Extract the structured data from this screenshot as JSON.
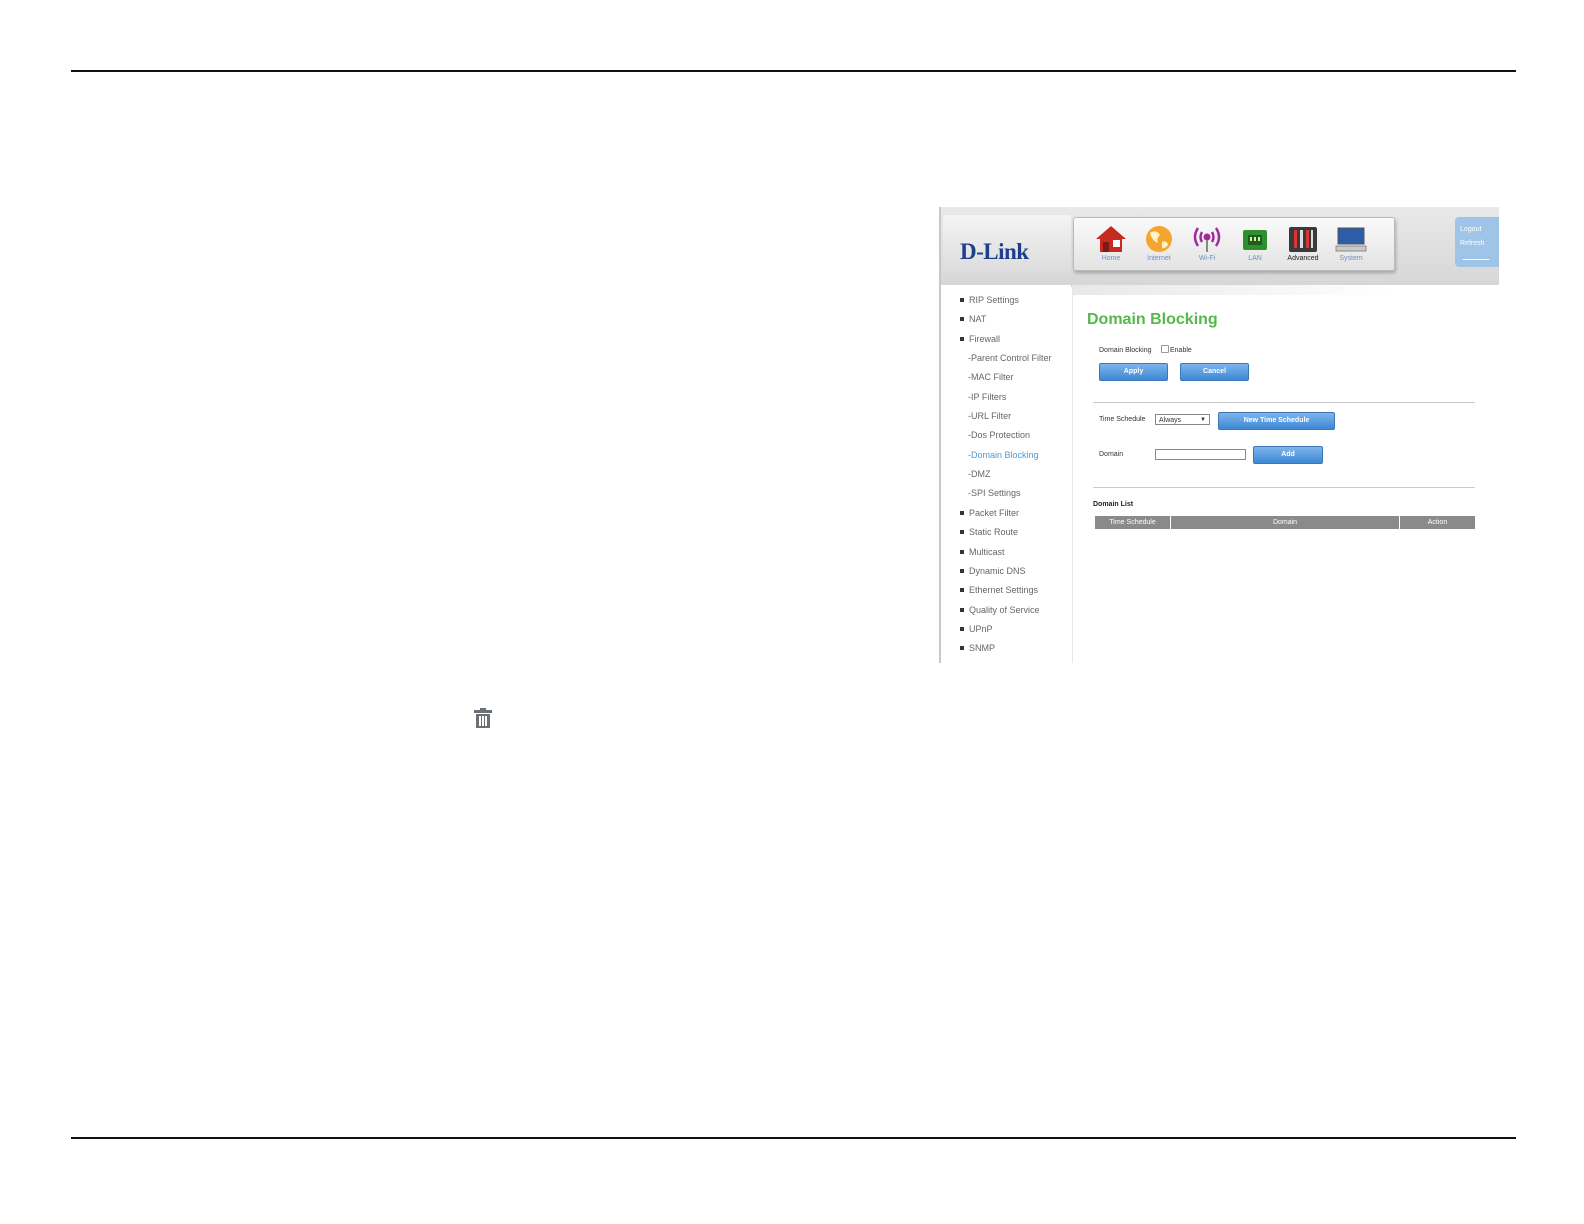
{
  "brand": {
    "logo": "D-Link"
  },
  "nav": [
    {
      "label": "Home",
      "icon": "home-icon"
    },
    {
      "label": "Internet",
      "icon": "globe-icon"
    },
    {
      "label": "Wi-Fi",
      "icon": "wifi-icon"
    },
    {
      "label": "LAN",
      "icon": "lan-icon"
    },
    {
      "label": "Advanced",
      "icon": "tools-icon",
      "active": true
    },
    {
      "label": "System",
      "icon": "monitor-icon"
    }
  ],
  "topright": {
    "logout": "Logout",
    "refresh": "Refresh"
  },
  "sidebar": [
    {
      "label": "RIP Settings"
    },
    {
      "label": "NAT"
    },
    {
      "label": "Firewall"
    },
    {
      "label": "-Parent Control Filter"
    },
    {
      "label": "-MAC Filter"
    },
    {
      "label": "-IP Filters"
    },
    {
      "label": "-URL Filter"
    },
    {
      "label": "-Dos Protection"
    },
    {
      "label": "-Domain Blocking",
      "active": true
    },
    {
      "label": "-DMZ"
    },
    {
      "label": "-SPI Settings"
    },
    {
      "label": "Packet Filter"
    },
    {
      "label": "Static Route"
    },
    {
      "label": "Multicast"
    },
    {
      "label": "Dynamic DNS"
    },
    {
      "label": "Ethernet Settings"
    },
    {
      "label": "Quality of Service"
    },
    {
      "label": "UPnP"
    },
    {
      "label": "SNMP"
    }
  ],
  "page": {
    "title": "Domain Blocking",
    "domain_blocking_label": "Domain Blocking",
    "enable_label": "Enable",
    "enable_checked": false,
    "apply": "Apply",
    "cancel": "Cancel",
    "time_schedule_label": "Time Schedule",
    "time_schedule_value": "Always",
    "new_time_schedule": "New Time Schedule",
    "domain_label": "Domain",
    "domain_value": "",
    "add": "Add",
    "domain_list_title": "Domain List",
    "columns": [
      "Time Schedule",
      "Domain",
      "Action"
    ]
  },
  "colors": {
    "accent_blue": "#4a9bd8",
    "title_green": "#55b84a",
    "logo_blue": "#1e3f8e"
  }
}
